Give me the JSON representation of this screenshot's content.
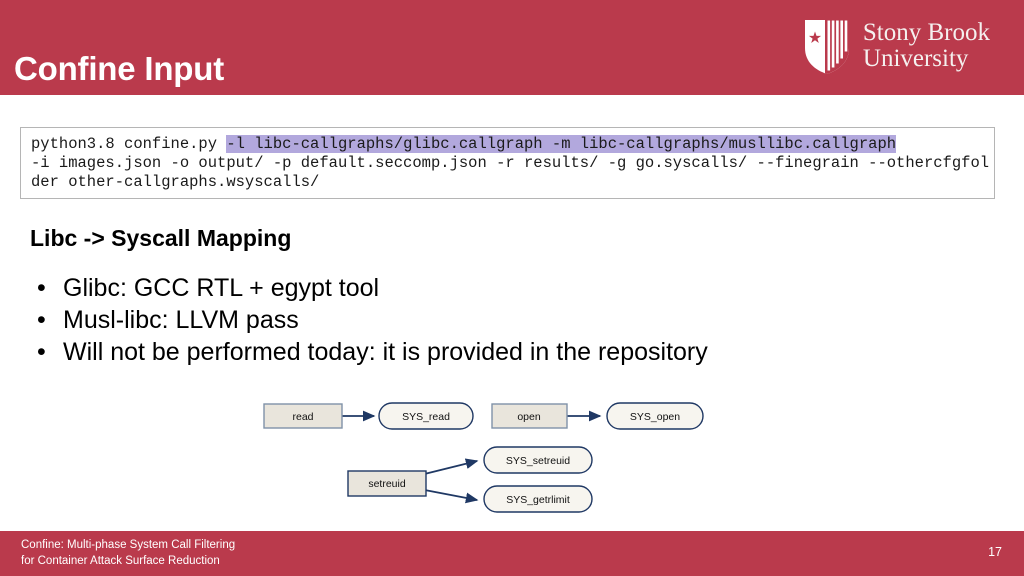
{
  "header": {
    "title": "Confine Input",
    "band_color": "#ba3a4c",
    "logo": {
      "name": "stony-brook-university-logo",
      "line1": "Stony Brook",
      "line2": "University"
    }
  },
  "code_block": {
    "prefix": "python3.8 confine.py ",
    "highlighted": "-l libc-callgraphs/glibc.callgraph -m libc-callgraphs/musllibc.callgraph",
    "suffix": "\n-i images.json -o output/ -p default.seccomp.json -r results/ -g go.syscalls/ --finegrain --othercfgfolder other-callgraphs.wsyscalls/",
    "highlight_color": "#b2a8dd",
    "border_color": "#b5b5b5"
  },
  "body": {
    "section_heading": "Libc -> Syscall Mapping",
    "bullet_char": "•",
    "bullets": [
      "Glibc: GCC RTL + egypt tool",
      "Musl-libc: LLVM pass",
      "Will not be performed today: it is provided in the repository"
    ]
  },
  "diagram": {
    "type": "flow",
    "node_fill_rect": "#e9e5dc",
    "node_fill_oval": "#f7f5ef",
    "rect_border": "#7f92a8",
    "oval_border": "#1f3864",
    "arrow_color": "#1f3864",
    "nodes": [
      {
        "id": "read",
        "label": "read",
        "shape": "rect"
      },
      {
        "id": "sys_read",
        "label": "SYS_read",
        "shape": "oval"
      },
      {
        "id": "open",
        "label": "open",
        "shape": "rect"
      },
      {
        "id": "sys_open",
        "label": "SYS_open",
        "shape": "oval"
      },
      {
        "id": "setreuid",
        "label": "setreuid",
        "shape": "rect"
      },
      {
        "id": "sys_setreuid",
        "label": "SYS_setreuid",
        "shape": "oval"
      },
      {
        "id": "sys_getrlimit",
        "label": "SYS_getrlimit",
        "shape": "oval"
      }
    ],
    "edges": [
      {
        "from": "read",
        "to": "sys_read"
      },
      {
        "from": "open",
        "to": "sys_open"
      },
      {
        "from": "setreuid",
        "to": "sys_setreuid"
      },
      {
        "from": "setreuid",
        "to": "sys_getrlimit"
      }
    ]
  },
  "footer": {
    "line1": "Confine: Multi-phase System Call Filtering",
    "line2": "for Container Attack Surface Reduction",
    "page_number": "17",
    "band_color": "#ba3a4c"
  }
}
